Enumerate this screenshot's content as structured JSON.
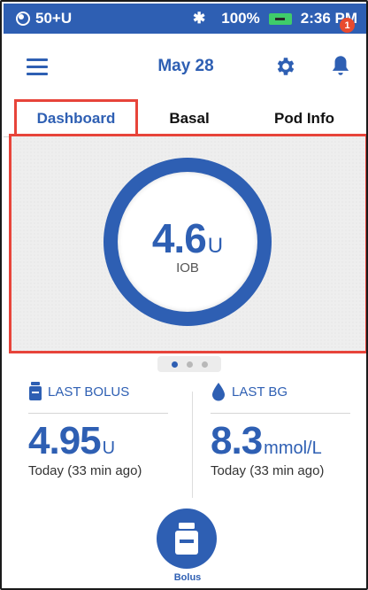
{
  "status_bar": {
    "profile": "50+U",
    "battery": "100%",
    "time": "2:36 PM"
  },
  "header": {
    "date": "May 28",
    "notification_count": "1"
  },
  "tabs": [
    {
      "label": "Dashboard",
      "active": true
    },
    {
      "label": "Basal",
      "active": false
    },
    {
      "label": "Pod Info",
      "active": false
    }
  ],
  "dashboard": {
    "iob_value": "4.6",
    "iob_unit": "U",
    "iob_label": "IOB",
    "page_count": 3,
    "active_page": 1
  },
  "last_bolus": {
    "label": "LAST BOLUS",
    "value": "4.95",
    "unit": "U",
    "time": "Today (33 min ago)"
  },
  "last_bg": {
    "label": "LAST BG",
    "value": "8.3",
    "unit": "mmol/L",
    "time": "Today (33 min ago)"
  },
  "bolus_button": {
    "label": "Bolus"
  },
  "colors": {
    "brand_blue": "#2e5fb3",
    "highlight_red": "#e7443a",
    "badge_red": "#e84a2e",
    "battery_green": "#3fcc6a"
  }
}
